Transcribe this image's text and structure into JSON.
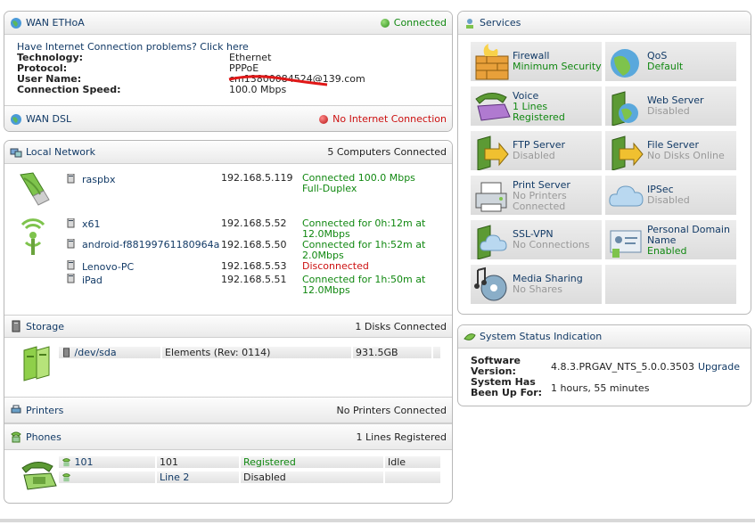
{
  "wan_ethoa": {
    "title": "WAN ETHoA",
    "status": "Connected",
    "problem_link": "Have Internet Connection problems? Click here",
    "rows": [
      {
        "label": "Technology:",
        "value": "Ethernet"
      },
      {
        "label": "Protocol:",
        "value": "PPPoE"
      },
      {
        "label": "User Name:",
        "value": "cm13800084524@139.com"
      },
      {
        "label": "Connection Speed:",
        "value": "100.0 Mbps"
      }
    ]
  },
  "wan_dsl": {
    "title": "WAN DSL",
    "status": "No Internet Connection"
  },
  "local_network": {
    "title": "Local Network",
    "summary": "5 Computers Connected",
    "wired": [
      {
        "name": "raspbx",
        "ip": "192.168.5.119",
        "status1": "Connected 100.0 Mbps",
        "status2": "Full-Duplex"
      }
    ],
    "wireless": [
      {
        "name": "x61",
        "ip": "192.168.5.52",
        "status1": "Connected for 0h:12m at",
        "status2": "12.0Mbps"
      },
      {
        "name": "android-f88199761180964a",
        "ip": "192.168.5.50",
        "status1": "Connected for 1h:52m at",
        "status2": "2.0Mbps"
      },
      {
        "name": "Lenovo-PC",
        "ip": "192.168.5.53",
        "status1": "Disconnected",
        "status2": ""
      },
      {
        "name": "iPad",
        "ip": "192.168.5.51",
        "status1": "Connected for 1h:50m at",
        "status2": "12.0Mbps"
      }
    ]
  },
  "storage": {
    "title": "Storage",
    "summary": "1 Disks Connected",
    "disk": {
      "path": "/dev/sda",
      "model": "Elements (Rev: 0114)",
      "size": "931.5GB"
    }
  },
  "printers": {
    "title": "Printers",
    "summary": "No Printers Connected"
  },
  "phones": {
    "title": "Phones",
    "summary": "1 Lines Registered",
    "lines": [
      {
        "number": "101",
        "name": "101",
        "status": "Registered",
        "state": "Idle"
      },
      {
        "number": "",
        "name": "Line 2",
        "status": "Disabled",
        "state": ""
      }
    ]
  },
  "services": {
    "title": "Services",
    "items": [
      {
        "name": "Firewall",
        "status": "Minimum Security"
      },
      {
        "name": "QoS",
        "status": "Default"
      },
      {
        "name": "Voice",
        "status": "1 Lines Registered"
      },
      {
        "name": "Web Server",
        "status": "Disabled"
      },
      {
        "name": "FTP Server",
        "status": "Disabled"
      },
      {
        "name": "File Server",
        "status": "No Disks Online"
      },
      {
        "name": "Print Server",
        "status": "No Printers Connected"
      },
      {
        "name": "IPSec",
        "status": "Disabled"
      },
      {
        "name": "SSL-VPN",
        "status": "No Connections"
      },
      {
        "name": "Personal Domain Name",
        "status": "Enabled"
      },
      {
        "name": "Media Sharing",
        "status": "No Shares"
      }
    ]
  },
  "system_status": {
    "title": "System Status Indication",
    "software_label": "Software Version:",
    "software_value": "4.8.3.PRGAV_NTS_5.0.0.3503",
    "upgrade": "Upgrade",
    "uptime_label": "System Has Been Up For:",
    "uptime_value": "1 hours, 55 minutes"
  },
  "colors": {
    "accent": "#123a66",
    "ok": "#118811",
    "error": "#cc1111"
  }
}
